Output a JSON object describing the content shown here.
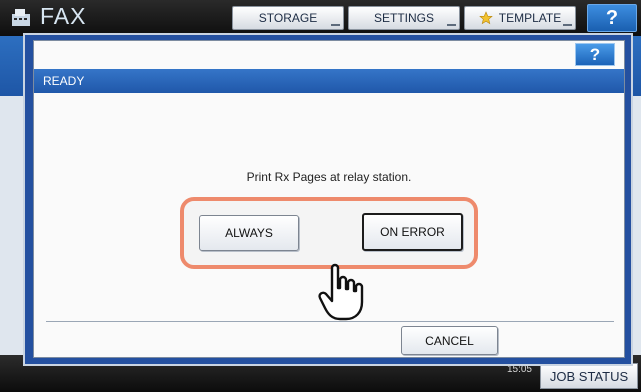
{
  "app": {
    "title": "FAX",
    "icon": "fax-icon"
  },
  "tabs": [
    {
      "label": "STORAGE"
    },
    {
      "label": "SETTINGS"
    },
    {
      "label": "TEMPLATE",
      "icon": "star-icon"
    }
  ],
  "help_label": "?",
  "dialog": {
    "help_label": "?",
    "status": "READY",
    "prompt": "Print Rx Pages at relay station.",
    "options": [
      {
        "label": "ALWAYS",
        "selected": false
      },
      {
        "label": "ON ERROR",
        "selected": true
      }
    ],
    "cancel_label": "CANCEL"
  },
  "footer": {
    "clock_time": "15:05",
    "job_status_label": "JOB STATUS"
  },
  "colors": {
    "accent_blue": "#2058aa",
    "highlight": "#ee8a6c"
  },
  "pointer_icon": "hand-pointer-icon"
}
